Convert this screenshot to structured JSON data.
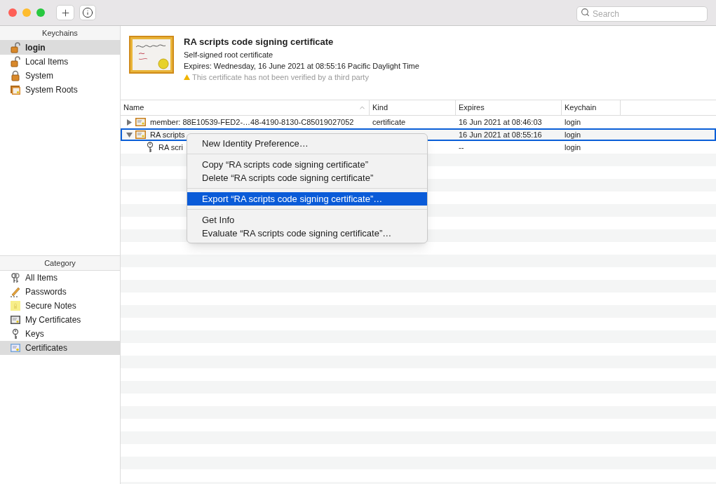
{
  "toolbar": {
    "search": {
      "placeholder": "Search"
    }
  },
  "keychains": {
    "title": "Keychains",
    "items": [
      {
        "label": "login",
        "kind": "open-lock",
        "selected": true
      },
      {
        "label": "Local Items",
        "kind": "open-lock",
        "selected": false
      },
      {
        "label": "System",
        "kind": "lock",
        "selected": false
      },
      {
        "label": "System Roots",
        "kind": "roots",
        "selected": false
      }
    ]
  },
  "category": {
    "title": "Category",
    "items": [
      {
        "label": "All Items",
        "kind": "all",
        "selected": false
      },
      {
        "label": "Passwords",
        "kind": "password",
        "selected": false
      },
      {
        "label": "Secure Notes",
        "kind": "note",
        "selected": false
      },
      {
        "label": "My Certificates",
        "kind": "my-cert",
        "selected": false
      },
      {
        "label": "Keys",
        "kind": "key",
        "selected": false
      },
      {
        "label": "Certificates",
        "kind": "cert",
        "selected": true
      }
    ]
  },
  "details": {
    "title": "RA scripts code signing certificate",
    "subtitle": "Self-signed root certificate",
    "expires": "Expires: Wednesday, 16 June 2021 at 08:55:16 Pacific Daylight Time",
    "warning": "This certificate has not been verified by a third party"
  },
  "table": {
    "columns": [
      {
        "label": "Name",
        "sorted": true
      },
      {
        "label": "Kind",
        "sorted": false
      },
      {
        "label": "Expires",
        "sorted": false
      },
      {
        "label": "Keychain",
        "sorted": false
      }
    ],
    "rows": [
      {
        "name": "member: 88E10539-FED2-…48-4190-8130-C85019027052",
        "kind_label": "certificate",
        "expires": "16 Jun 2021 at 08:46:03",
        "keychain": "login",
        "kind": "cert",
        "expanded": false,
        "selected": false
      },
      {
        "name": "RA scripts",
        "expires": "16 Jun 2021 at 08:55:16",
        "keychain": "login",
        "kind": "cert",
        "expanded": true,
        "selected": true,
        "children": [
          {
            "name": "RA scri",
            "expires": "--",
            "keychain": "login",
            "kind": "key",
            "selected": false
          }
        ]
      }
    ]
  },
  "context_menu": {
    "groups": [
      [
        {
          "label": "New Identity Preference…",
          "selected": false
        }
      ],
      [
        {
          "label": "Copy “RA scripts code signing certificate”",
          "selected": false
        },
        {
          "label": "Delete “RA scripts code signing certificate”",
          "selected": false
        }
      ],
      [
        {
          "label": "Export “RA scripts code signing certificate”…",
          "selected": true
        }
      ],
      [
        {
          "label": "Get Info",
          "selected": false
        },
        {
          "label": "Evaluate “RA scripts code signing certificate”…",
          "selected": false
        }
      ]
    ]
  }
}
